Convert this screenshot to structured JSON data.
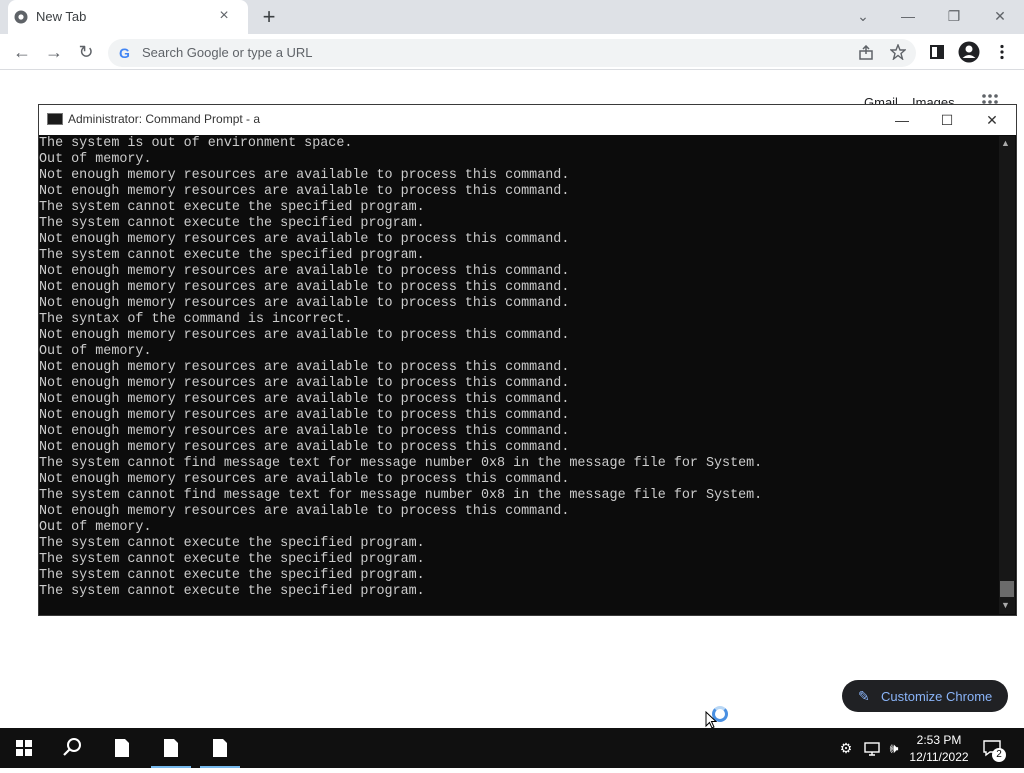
{
  "browser": {
    "tab_title": "New Tab",
    "tab_close": "×",
    "new_tab": "+",
    "omnibox_placeholder": "Search Google or type a URL",
    "omnibox_g": "G",
    "window_controls": {
      "dropdown": "⌄",
      "minimize": "—",
      "restore": "❐",
      "close": "✕"
    },
    "nav": {
      "back": "←",
      "forward": "→",
      "reload": "↻"
    },
    "toolbar_icons": [
      "share-icon",
      "star-icon",
      "side-panel-icon",
      "profile-icon",
      "menu-icon"
    ]
  },
  "page": {
    "gmail_link": "Gmail",
    "images_link": "Images",
    "customize_label": "Customize Chrome",
    "customize_icon": "✎"
  },
  "cmd": {
    "title": "Administrator: Command Prompt - a",
    "controls": {
      "minimize": "—",
      "maximize": "☐",
      "close": "✕"
    },
    "lines": [
      "The system is out of environment space.",
      "Out of memory.",
      "Not enough memory resources are available to process this command.",
      "Not enough memory resources are available to process this command.",
      "The system cannot execute the specified program.",
      "The system cannot execute the specified program.",
      "Not enough memory resources are available to process this command.",
      "The system cannot execute the specified program.",
      "Not enough memory resources are available to process this command.",
      "Not enough memory resources are available to process this command.",
      "Not enough memory resources are available to process this command.",
      "The syntax of the command is incorrect.",
      "Not enough memory resources are available to process this command.",
      "Out of memory.",
      "Not enough memory resources are available to process this command.",
      "Not enough memory resources are available to process this command.",
      "Not enough memory resources are available to process this command.",
      "Not enough memory resources are available to process this command.",
      "Not enough memory resources are available to process this command.",
      "Not enough memory resources are available to process this command.",
      "The system cannot find message text for message number 0x8 in the message file for System.",
      "Not enough memory resources are available to process this command.",
      "The system cannot find message text for message number 0x8 in the message file for System.",
      "Not enough memory resources are available to process this command.",
      "Out of memory.",
      "The system cannot execute the specified program.",
      "The system cannot execute the specified program.",
      "The system cannot execute the specified program.",
      "The system cannot execute the specified program."
    ]
  },
  "taskbar": {
    "time": "2:53 PM",
    "date": "12/11/2022",
    "notification_count": "2",
    "items": [
      "start-icon",
      "search-icon",
      "file-icon",
      "file-icon",
      "file-icon"
    ],
    "tray": [
      "security-icon",
      "network-icon",
      "volume-icon",
      "notifications-icon"
    ]
  },
  "colors": {
    "chrome_tabstrip": "#dee1e6",
    "cmd_bg": "#0c0c0c",
    "cmd_text": "#cccccc",
    "taskbar": "#101010",
    "accent": "#8ab4f8"
  }
}
